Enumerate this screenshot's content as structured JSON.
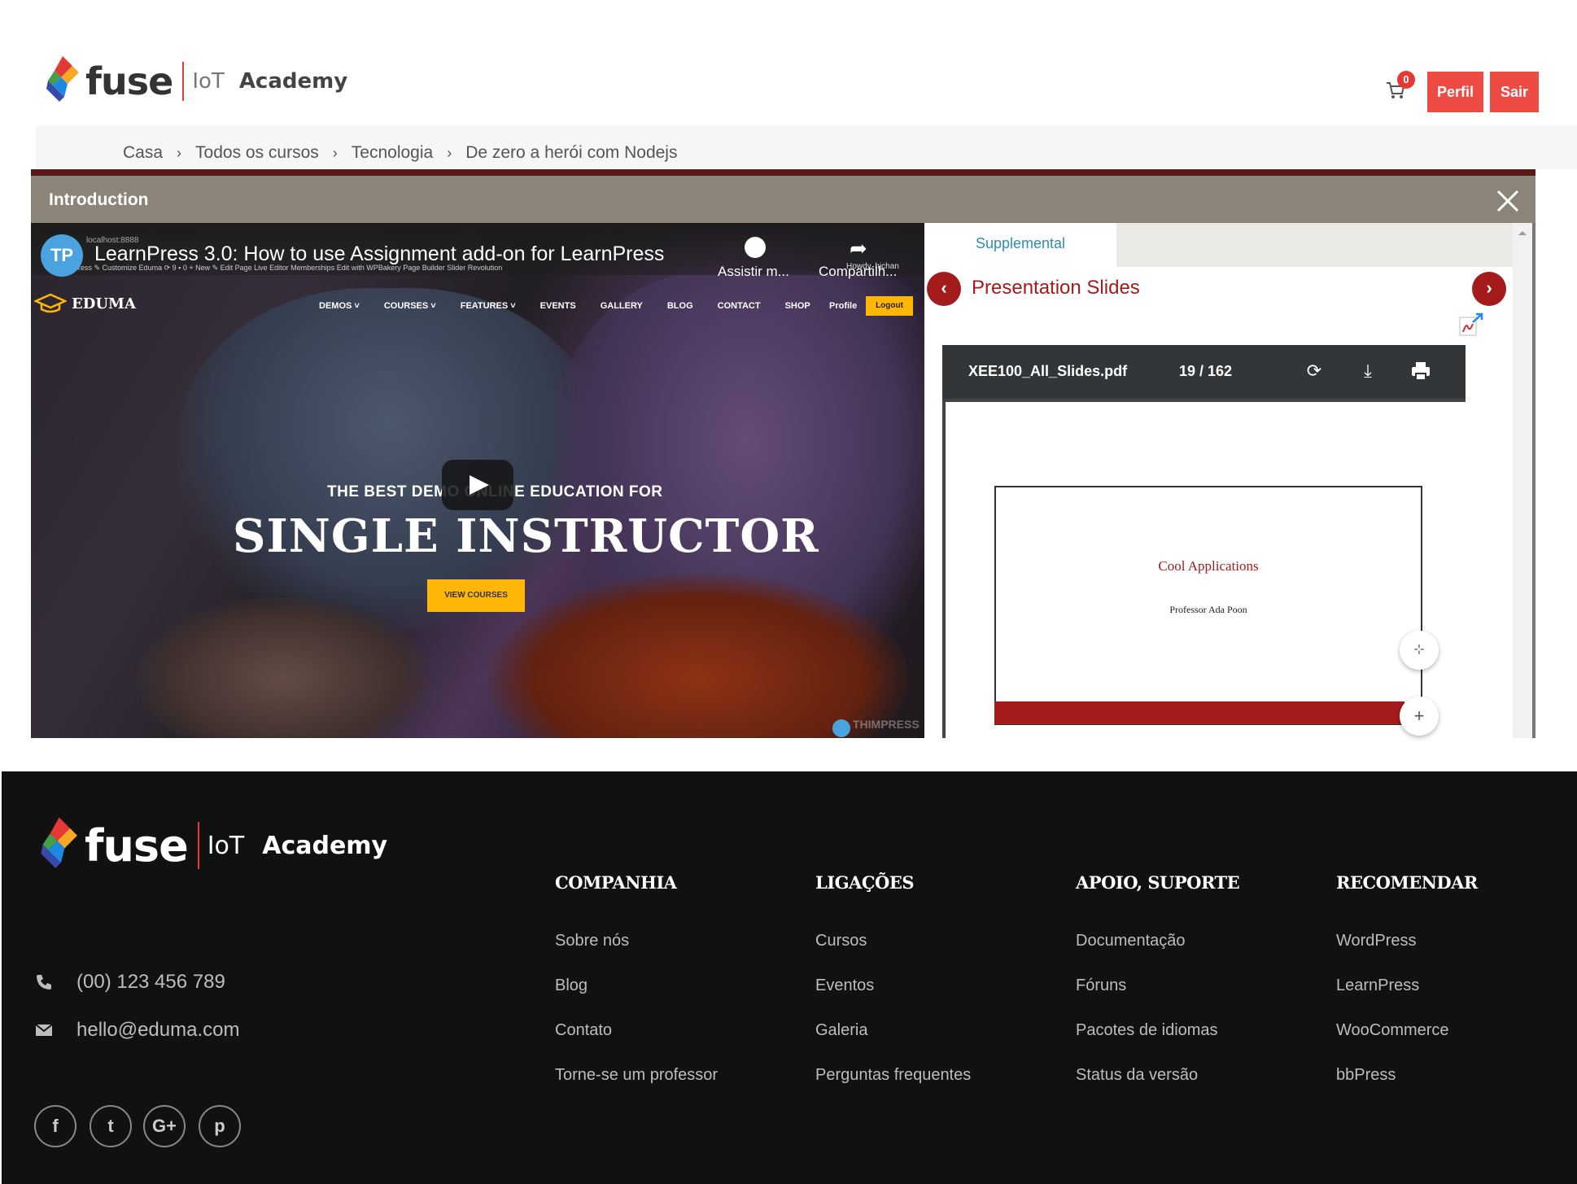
{
  "header": {
    "logo": {
      "word": "fuse",
      "iot": "IoT",
      "academy": "Academy"
    },
    "cart_count": "0",
    "profile_label": "Perfil",
    "logout_label": "Sair"
  },
  "breadcrumb": [
    "Casa",
    "Todos os cursos",
    "Tecnologia",
    "De zero a herói com Nodejs"
  ],
  "breadcrumb_sep": "›",
  "lesson": {
    "title": "Introduction",
    "video": {
      "url": "localhost:8888",
      "title": "LearnPress 3.0: How to use Assignment add-on for LearnPress",
      "channel_icon": "TP",
      "admin_bar": "ress  ✎ Customize   Eduma   ⟳ 9   ▪ 0   + New   ✎ Edit Page   Live Editor   Memberships   Edit with WPBakery Page Builder   Slider Revolution",
      "watch_later": "Assistir m...",
      "share": "Compartilh...",
      "howdy": "Howdy, hichan",
      "site_logo": "EDUMA",
      "nav": [
        "DEMOS ˅",
        "COURSES ˅",
        "FEATURES ˅",
        "EVENTS",
        "GALLERY",
        "BLOG",
        "CONTACT",
        "SHOP"
      ],
      "profile": "Profile",
      "logout": "Logout",
      "tagline": "THE BEST DEMO ONLINE EDUCATION FOR",
      "headline": "SINGLE INSTRUCTOR",
      "cta": "VIEW COURSES",
      "watermark": "THIMPRESS"
    },
    "supplemental": {
      "tab": "Supplemental",
      "section_title": "Presentation Slides",
      "pdf": {
        "filename": "XEE100_All_Slides.pdf",
        "pages": "19 / 162",
        "slide_title": "Cool Applications",
        "slide_subtitle": "Professor Ada Poon"
      }
    }
  },
  "footer": {
    "logo": {
      "word": "fuse",
      "iot": "IoT",
      "academy": "Academy"
    },
    "phone": "(00) 123 456 789",
    "email": "hello@eduma.com",
    "social": [
      "f",
      "t",
      "G+",
      "p"
    ],
    "columns": [
      {
        "title": "COMPANHIA",
        "links": [
          "Sobre nós",
          "Blog",
          "Contato",
          "Torne-se um professor"
        ]
      },
      {
        "title": "LIGAÇÕES",
        "links": [
          "Cursos",
          "Eventos",
          "Galeria",
          "Perguntas frequentes"
        ]
      },
      {
        "title": "APOIO, SUPORTE",
        "links": [
          "Documentação",
          "Fóruns",
          "Pacotes de idiomas",
          "Status da versão"
        ]
      },
      {
        "title": "RECOMENDAR",
        "links": [
          "WordPress",
          "LearnPress",
          "WooCommerce",
          "bbPress"
        ]
      }
    ]
  },
  "colors": {
    "accent_red": "#ef4b45",
    "dark_red": "#a31b1b",
    "footer_bg": "#111111",
    "supplemental_tab": "#2b8fae",
    "cta_yellow": "#ffb606"
  }
}
